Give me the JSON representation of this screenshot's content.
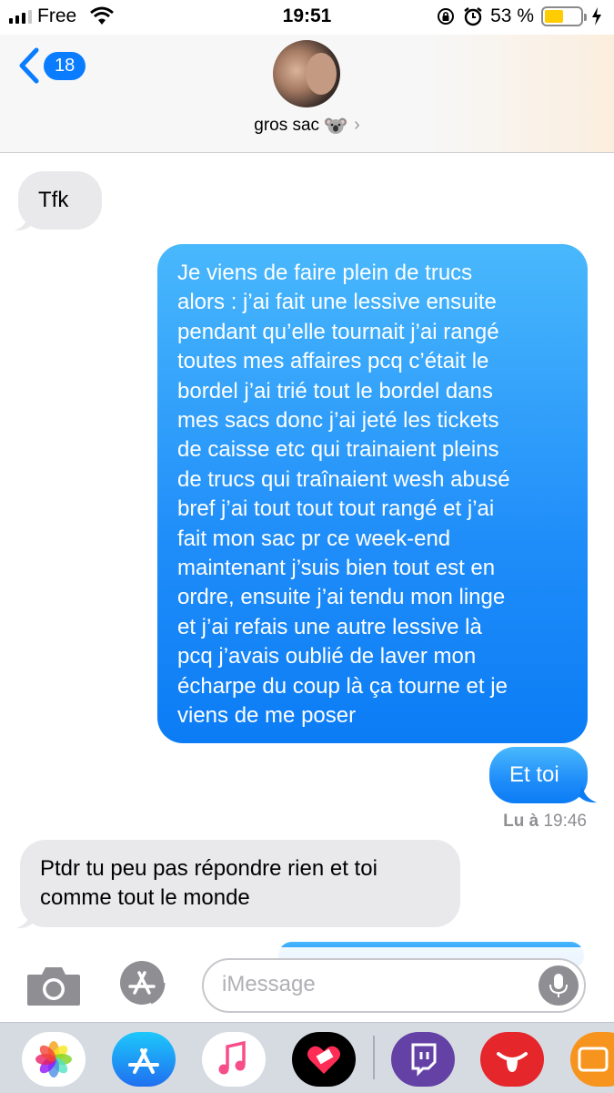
{
  "status_bar": {
    "carrier": "Free",
    "time": "19:51",
    "battery_percent": "53 %",
    "battery_level": 0.53
  },
  "header": {
    "back_badge": "18",
    "contact_name": "gros sac"
  },
  "messages": [
    {
      "direction": "incoming",
      "text": "Tfk"
    },
    {
      "direction": "outgoing",
      "lines": [
        "Je viens de faire plein de trucs",
        "alors : j’ai fait une lessive ensuite",
        "pendant qu’elle tournait j’ai rangé",
        "toutes mes affaires pcq c’était le",
        "bordel j’ai trié tout le bordel dans",
        "mes sacs donc j’ai jeté les tickets",
        "de caisse etc qui trainaient pleins",
        "de trucs qui traînaient wesh abusé",
        "bref j’ai tout tout tout rangé et j’ai",
        "fait mon sac pr ce week-end",
        "maintenant j’suis bien tout est en",
        "ordre, ensuite j’ai tendu mon linge",
        "et j’ai refais une autre lessive là",
        "pcq j’avais oublié de laver mon",
        "écharpe du coup là ça tourne et je",
        "viens de me poser"
      ]
    },
    {
      "direction": "outgoing",
      "text": "Et toi"
    },
    {
      "direction": "incoming",
      "lines": [
        "Ptdr tu peu pas répondre rien et toi",
        "comme tout le monde"
      ]
    }
  ],
  "read_receipt": {
    "label": "Lu à",
    "time": "19:46"
  },
  "composer": {
    "placeholder": "iMessage"
  },
  "app_drawer": [
    "photos-app-icon",
    "app-store-icon",
    "music-app-icon",
    "heart-sticker-app-icon",
    "twitch-app-icon",
    "tongue-sticker-app-icon",
    "orange-app-icon"
  ],
  "colors": {
    "outgoing_bubble": "#1f8df9",
    "incoming_bubble": "#e9e9eb",
    "badge": "#0a7cff",
    "battery": "#ffcc00"
  }
}
